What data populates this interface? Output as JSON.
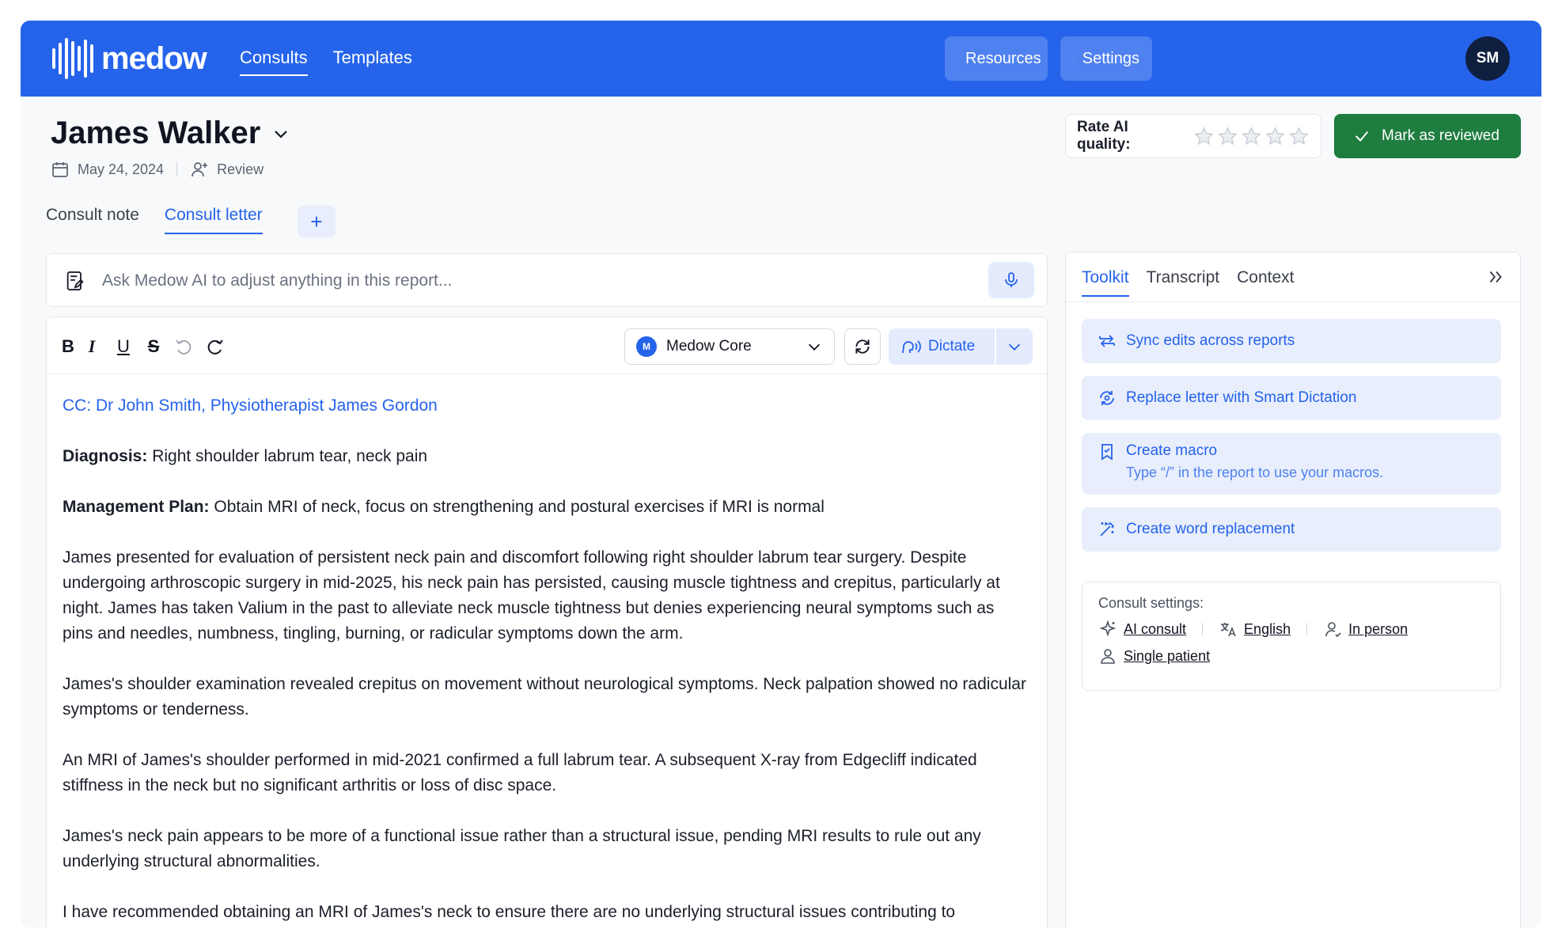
{
  "header": {
    "logo_text": "medow",
    "nav": [
      {
        "label": "Consults"
      },
      {
        "label": "Templates"
      }
    ],
    "resources_label": "Resources",
    "settings_label": "Settings",
    "avatar_initials": "SM"
  },
  "patient": {
    "name": "James Walker",
    "date": "May 24, 2024",
    "status": "Review"
  },
  "rating": {
    "label": "Rate AI quality:",
    "stars_filled": 0,
    "stars_total": 5
  },
  "review_button": "Mark as reviewed",
  "doc_tabs": [
    {
      "label": "Consult note"
    },
    {
      "label": "Consult letter"
    }
  ],
  "add_tab": "+",
  "ai_prompt": {
    "placeholder": "Ask Medow AI to adjust anything in this report..."
  },
  "editor": {
    "model": "Medow Core",
    "model_badge": "M",
    "dictate_label": "Dictate",
    "format_buttons": {
      "bold": "B",
      "italic": "I",
      "underline": "U",
      "strike": "S"
    },
    "cc": "CC: Dr John Smith, Physiotherapist James Gordon",
    "diagnosis_label": "Diagnosis:",
    "diagnosis_text": " Right shoulder labrum tear, neck pain",
    "plan_label": "Management Plan:",
    "plan_text": " Obtain MRI of neck, focus on strengthening and postural exercises if MRI is normal",
    "paragraphs": [
      "James presented for evaluation of persistent neck pain and discomfort following right shoulder labrum tear surgery. Despite undergoing arthroscopic surgery in mid-2025, his neck pain has persisted, causing muscle tightness and crepitus, particularly at night. James has taken Valium in the past to alleviate neck muscle tightness but denies experiencing neural symptoms such as pins and needles, numbness, tingling, burning, or radicular symptoms down the arm.",
      "James's shoulder examination revealed crepitus on movement without neurological symptoms. Neck palpation showed no radicular symptoms or tenderness.",
      "An MRI of James's shoulder performed in mid-2021 confirmed a full labrum tear. A subsequent X-ray from Edgecliff indicated stiffness in the neck but no significant arthritis or loss of disc space.",
      "James's neck pain appears to be more of a functional issue rather than a structural issue, pending MRI results to rule out any underlying structural abnormalities.",
      "I have recommended obtaining an MRI of James's neck to ensure there are no underlying structural issues contributing to"
    ]
  },
  "side_panel": {
    "tabs": [
      {
        "label": "Toolkit"
      },
      {
        "label": "Transcript"
      },
      {
        "label": "Context"
      }
    ],
    "tools": [
      {
        "label": "Sync edits across reports"
      },
      {
        "label": "Replace letter with Smart Dictation"
      },
      {
        "label": "Create macro",
        "sub": "Type “/” in the report to use your macros."
      },
      {
        "label": "Create word replacement"
      }
    ],
    "consult_settings": {
      "title": "Consult settings:",
      "type": "AI consult",
      "language": "English",
      "mode": "In person",
      "patients": "Single patient"
    }
  },
  "colors": {
    "brand": "#2563eb",
    "review_green": "#1e7d3f",
    "avatar_bg": "#0f1f40"
  }
}
